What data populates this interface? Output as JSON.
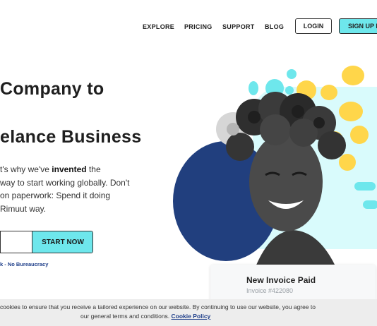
{
  "nav": {
    "links": [
      "EXPLORE",
      "PRICING",
      "SUPPORT",
      "BLOG"
    ],
    "login_label": "LOGIN",
    "signup_label": "SIGN UP F"
  },
  "hero": {
    "title_line1": "Company to",
    "title_line2": "elance Business",
    "body_line1_pre": "t's why we've ",
    "body_line1_bold": "invented",
    "body_line1_post": " the",
    "body_line2": "way to start working globally. Don't",
    "body_line3": "on paperwork: Spend it doing",
    "body_line4": "Rimuut way.",
    "cta_label": "START NOW",
    "email_placeholder": "",
    "note": "k - No Bureaucracy"
  },
  "invoice": {
    "title": "New Invoice Paid",
    "number": "Invoice #422080"
  },
  "cookie": {
    "line1": "cookies to ensure that you receive a tailored experience on our website. By continuing to use our website, you agree to",
    "line2_text": "our general terms and conditions.",
    "link_label": "Cookie Policy"
  },
  "colors": {
    "accent_cyan": "#6ee7ec",
    "navy_circle": "#213f7e",
    "yellow_dots": "#ffd64a",
    "link_blue": "#1f3f8a"
  }
}
